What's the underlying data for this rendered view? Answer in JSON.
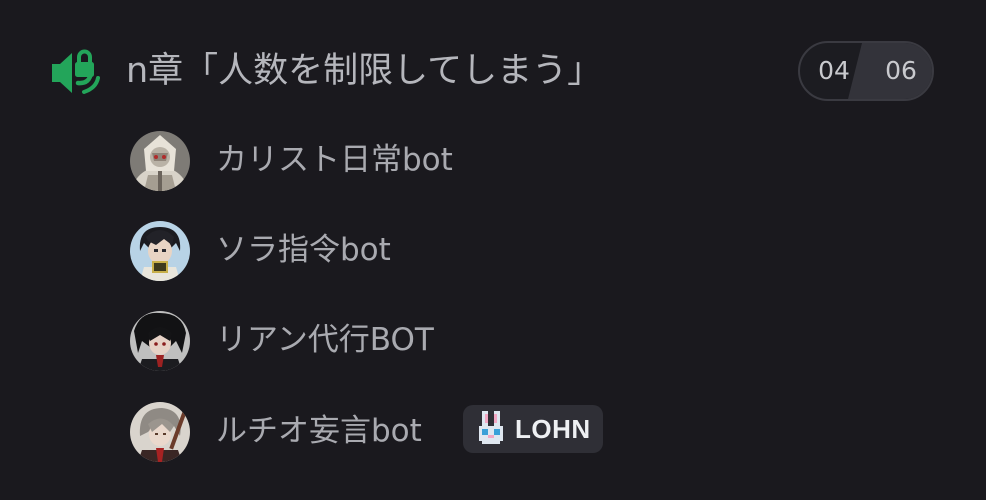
{
  "channel": {
    "name": "n章「人数を制限してしまう」",
    "icon": "speaker-lock-icon",
    "accent_color": "#23a55a",
    "user_limit": {
      "current": "04",
      "max": "06"
    }
  },
  "members": [
    {
      "name": "カリスト日常bot",
      "avatar": "avatar-image"
    },
    {
      "name": "ソラ指令bot",
      "avatar": "avatar-image"
    },
    {
      "name": "リアン代行BOT",
      "avatar": "avatar-image"
    },
    {
      "name": "ルチオ妄言bot",
      "avatar": "avatar-image",
      "tag": {
        "icon": "rabbit-icon",
        "label": "LOHN"
      }
    }
  ]
}
